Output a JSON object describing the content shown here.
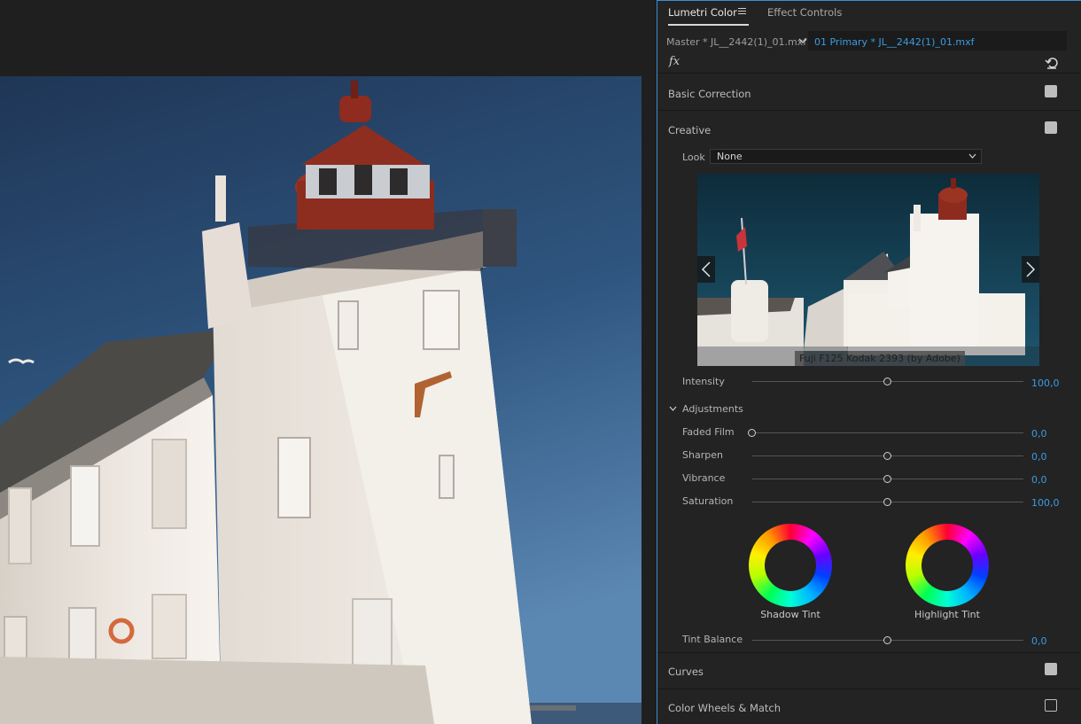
{
  "panel": {
    "tabs": [
      {
        "label": "Lumetri Color",
        "active": true
      },
      {
        "label": "Effect Controls",
        "active": false
      }
    ],
    "clip": {
      "master": "Master * JL__2442(1)_01.mxf",
      "primary": "01 Primary * JL__2442(1)_01.mxf"
    },
    "fx_symbol": "fx",
    "sections": {
      "basic_correction": {
        "title": "Basic Correction",
        "enabled": true
      },
      "creative": {
        "title": "Creative",
        "enabled": true
      },
      "curves": {
        "title": "Curves",
        "enabled": true
      },
      "color_wheels": {
        "title": "Color Wheels & Match",
        "enabled": false
      }
    },
    "creative": {
      "look_label": "Look",
      "look_value": "None",
      "preview_caption": "Fuji F125 Kodak 2393 (by Adobe)",
      "intensity": {
        "label": "Intensity",
        "value_text": "100,0",
        "position": 0.5
      },
      "adjustments_title": "Adjustments",
      "adjustments": [
        {
          "label": "Faded Film",
          "value_text": "0,0",
          "position": 0.0
        },
        {
          "label": "Sharpen",
          "value_text": "0,0",
          "position": 0.5
        },
        {
          "label": "Vibrance",
          "value_text": "0,0",
          "position": 0.5
        },
        {
          "label": "Saturation",
          "value_text": "100,0",
          "position": 0.5
        }
      ],
      "shadow_tint_label": "Shadow Tint",
      "highlight_tint_label": "Highlight Tint",
      "tint_balance": {
        "label": "Tint Balance",
        "value_text": "0,0",
        "position": 0.5
      }
    }
  },
  "colors": {
    "accent_blue": "#3a9be4",
    "panel_bg": "#232323",
    "sky": "#2d4f74"
  },
  "icons": {
    "menu": "hamburger-icon",
    "clip_dropdown": "chevron-down-icon",
    "reset": "reset-icon",
    "prev": "chevron-left-icon",
    "next": "chevron-right-icon"
  }
}
